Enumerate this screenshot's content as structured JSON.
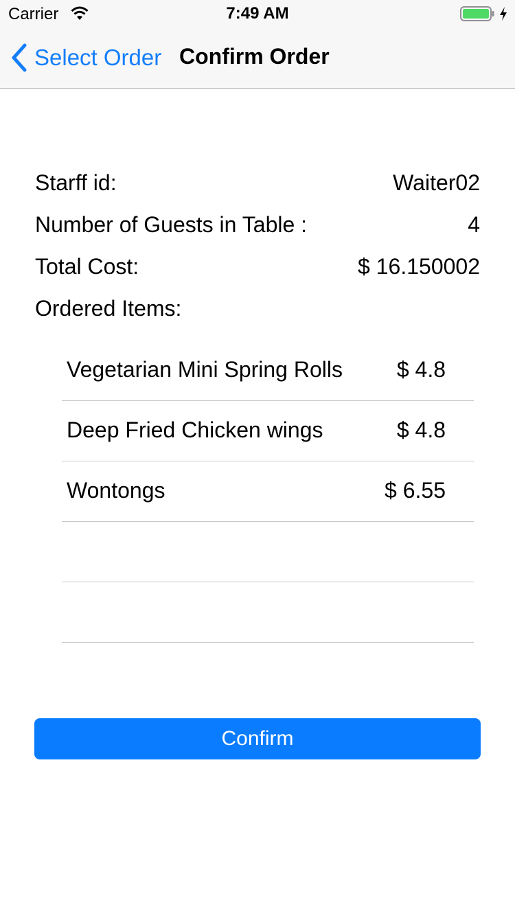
{
  "status_bar": {
    "carrier": "Carrier",
    "time": "7:49 AM",
    "icons": [
      "wifi-icon",
      "battery-icon",
      "charging-bolt-icon"
    ],
    "battery_color": "#4cd964"
  },
  "nav": {
    "back_label": "Select Order",
    "back_icon": "chevron-left-icon",
    "title": "Confirm Order",
    "tint_color": "#147efb"
  },
  "summary": {
    "staff_label": "Starff id:",
    "staff_value": "Waiter02",
    "guests_label": "Number of Guests in Table :",
    "guests_value": "4",
    "total_label": "Total Cost:",
    "total_value": "$ 16.150002",
    "items_label": "Ordered Items:"
  },
  "items": [
    {
      "name": "Vegetarian Mini Spring Rolls",
      "price": "$ 4.8"
    },
    {
      "name": "Deep Fried Chicken wings",
      "price": "$ 4.8"
    },
    {
      "name": "Wontongs",
      "price": "$ 6.55"
    },
    {
      "name": "",
      "price": ""
    },
    {
      "name": "",
      "price": ""
    }
  ],
  "confirm_button": {
    "label": "Confirm",
    "color": "#0a7cff"
  }
}
